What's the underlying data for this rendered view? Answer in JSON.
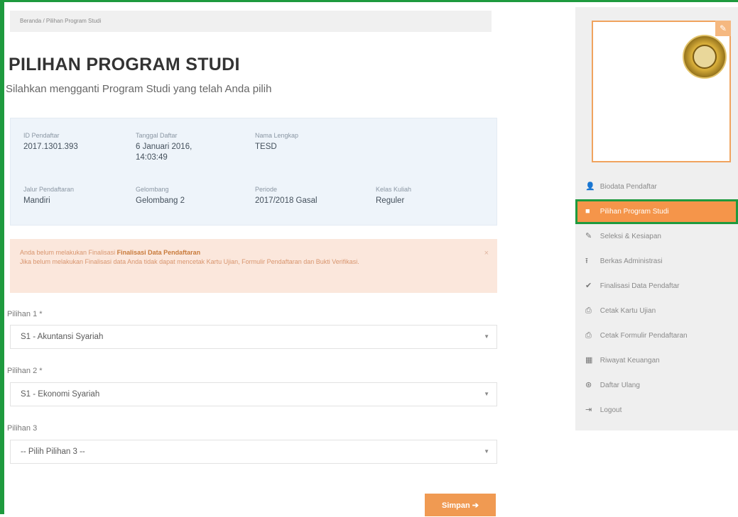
{
  "breadcrumb": "Beranda / Pilihan Program Studi",
  "page": {
    "title": "PILIHAN PROGRAM STUDI",
    "subtitle": "Silahkan mengganti Program Studi yang telah Anda pilih"
  },
  "info": {
    "no_pendaftar": {
      "label": "ID Pendaftar",
      "value": "2017.1301.393"
    },
    "tanggal_daftar": {
      "label": "Tanggal Daftar",
      "value": "6 Januari 2016, 14:03:49"
    },
    "nama_lengkap": {
      "label": "Nama Lengkap",
      "value": "TESD"
    },
    "jalur": {
      "label": "Jalur Pendaftaran",
      "value": "Mandiri"
    },
    "gelombang": {
      "label": "Gelombang",
      "value": "Gelombang 2"
    },
    "periode": {
      "label": "Periode",
      "value": "2017/2018 Gasal"
    },
    "kelas": {
      "label": "Kelas Kuliah",
      "value": "Reguler"
    }
  },
  "alert": {
    "line1_prefix": "Anda belum melakukan Finalisasi",
    "line1_link": "Finalisasi Data Pendaftaran",
    "line2": "Jika belum melakukan Finalisasi data Anda tidak dapat mencetak Kartu Ujian, Formulir Pendaftaran dan Bukti Verifikasi.",
    "close": "×"
  },
  "form": {
    "pilihan1": {
      "label": "Pilihan 1 *",
      "value": "S1 - Akuntansi Syariah"
    },
    "pilihan2": {
      "label": "Pilihan 2 *",
      "value": "S1 - Ekonomi Syariah"
    },
    "pilihan3": {
      "label": "Pilihan 3",
      "value": "-- Pilih Pilihan 3 --"
    },
    "submit": "Simpan ➔"
  },
  "sidebar": {
    "edit_icon": "✎",
    "items": [
      {
        "icon": "user-icon",
        "glyph": "👤",
        "label": "Biodata Pendaftar"
      },
      {
        "icon": "bookmark-icon",
        "glyph": "■",
        "label": "Pilihan Program Studi"
      },
      {
        "icon": "edit-icon",
        "glyph": "✎",
        "label": "Seleksi & Kesiapan"
      },
      {
        "icon": "upload-icon",
        "glyph": "⭱",
        "label": "Berkas Administrasi"
      },
      {
        "icon": "check-icon",
        "glyph": "✔",
        "label": "Finalisasi Data Pendaftar"
      },
      {
        "icon": "print-icon",
        "glyph": "⎙",
        "label": "Cetak Kartu Ujian"
      },
      {
        "icon": "print-icon",
        "glyph": "⎙",
        "label": "Cetak Formulir Pendaftaran"
      },
      {
        "icon": "table-icon",
        "glyph": "▦",
        "label": "Riwayat Keuangan"
      },
      {
        "icon": "money-icon",
        "glyph": "⊛",
        "label": "Daftar Ulang"
      },
      {
        "icon": "logout-icon",
        "glyph": "⇥",
        "label": "Logout"
      }
    ]
  },
  "colors": {
    "accent": "#f5954a",
    "highlight": "#1e9a3e"
  }
}
